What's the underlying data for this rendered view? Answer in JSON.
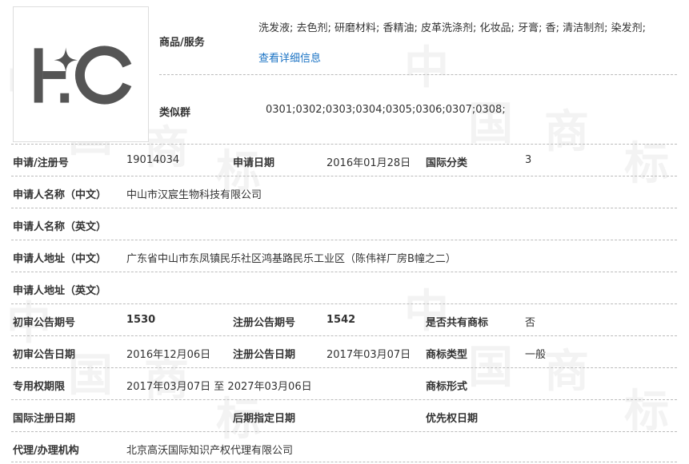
{
  "goods": {
    "label": "商品/服务",
    "items": "洗发液; 去色剂; 研磨材料; 香精油; 皮革洗涤剂; 化妆品; 牙膏; 香; 清洁制剂; 染发剂;",
    "more_link": "查看详细信息"
  },
  "similar_group": {
    "label": "类似群",
    "value": "0301;0302;0303;0304;0305;0306;0307;0308;"
  },
  "fields": {
    "reg_no_label": "申请/注册号",
    "reg_no": "19014034",
    "apply_date_label": "申请日期",
    "apply_date": "2016年01月28日",
    "intl_class_label": "国际分类",
    "intl_class": "3",
    "applicant_cn_label": "申请人名称（中文）",
    "applicant_cn": "中山市汉宸生物科技有限公司",
    "applicant_en_label": "申请人名称（英文）",
    "applicant_en": "",
    "address_cn_label": "申请人地址（中文）",
    "address_cn": "广东省中山市东凤镇民乐社区鸿基路民乐工业区（陈伟祥厂房B幢之二）",
    "address_en_label": "申请人地址（英文）",
    "address_en": "",
    "prelim_pub_no_label": "初审公告期号",
    "prelim_pub_no": "1530",
    "reg_pub_no_label": "注册公告期号",
    "reg_pub_no": "1542",
    "shared_label": "是否共有商标",
    "shared": "否",
    "prelim_pub_date_label": "初审公告日期",
    "prelim_pub_date": "2016年12月06日",
    "reg_pub_date_label": "注册公告日期",
    "reg_pub_date": "2017年03月07日",
    "tm_type_label": "商标类型",
    "tm_type": "一般",
    "exclusive_period_label": "专用权期限",
    "exclusive_period": "2017年03月07日 至 2027年03月06日",
    "tm_form_label": "商标形式",
    "tm_form": "",
    "intl_reg_date_label": "国际注册日期",
    "intl_reg_date": "",
    "later_designation_label": "后期指定日期",
    "later_designation": "",
    "priority_date_label": "优先权日期",
    "priority_date": "",
    "agent_label": "代理/办理机构",
    "agent": "北京高沃国际知识产权代理有限公司"
  },
  "logo": {
    "text": "HC",
    "icon": "trademark-hc-logo",
    "color": "#555555"
  },
  "colors": {
    "link": "#1b73c4",
    "text": "#333333",
    "divider": "#bbbbbb"
  }
}
